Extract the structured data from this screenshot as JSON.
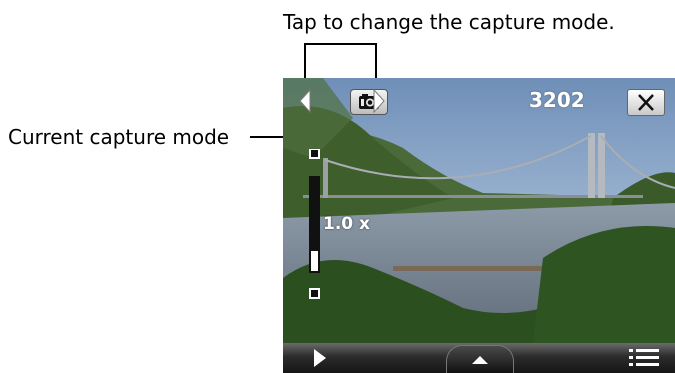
{
  "callouts": {
    "change_mode": "Tap to change the capture mode.",
    "current_mode": "Current capture mode"
  },
  "camera": {
    "shot_count": "3202",
    "zoom": "1.0 x",
    "prev_mode_icon": "triangle-left-icon",
    "next_mode_icon": "triangle-right-icon",
    "mode_icon": "camera-icon",
    "close_icon": "close-icon",
    "bottom_bar": {
      "play_icon": "play-icon",
      "expand_icon": "chevron-up-icon",
      "menu_icon": "menu-icon"
    }
  },
  "colors": {
    "sky_top": "#6f8fb8",
    "sky_bottom": "#c7d6e8",
    "water": "#6f7d8c",
    "trees": "#2c4f1f"
  }
}
